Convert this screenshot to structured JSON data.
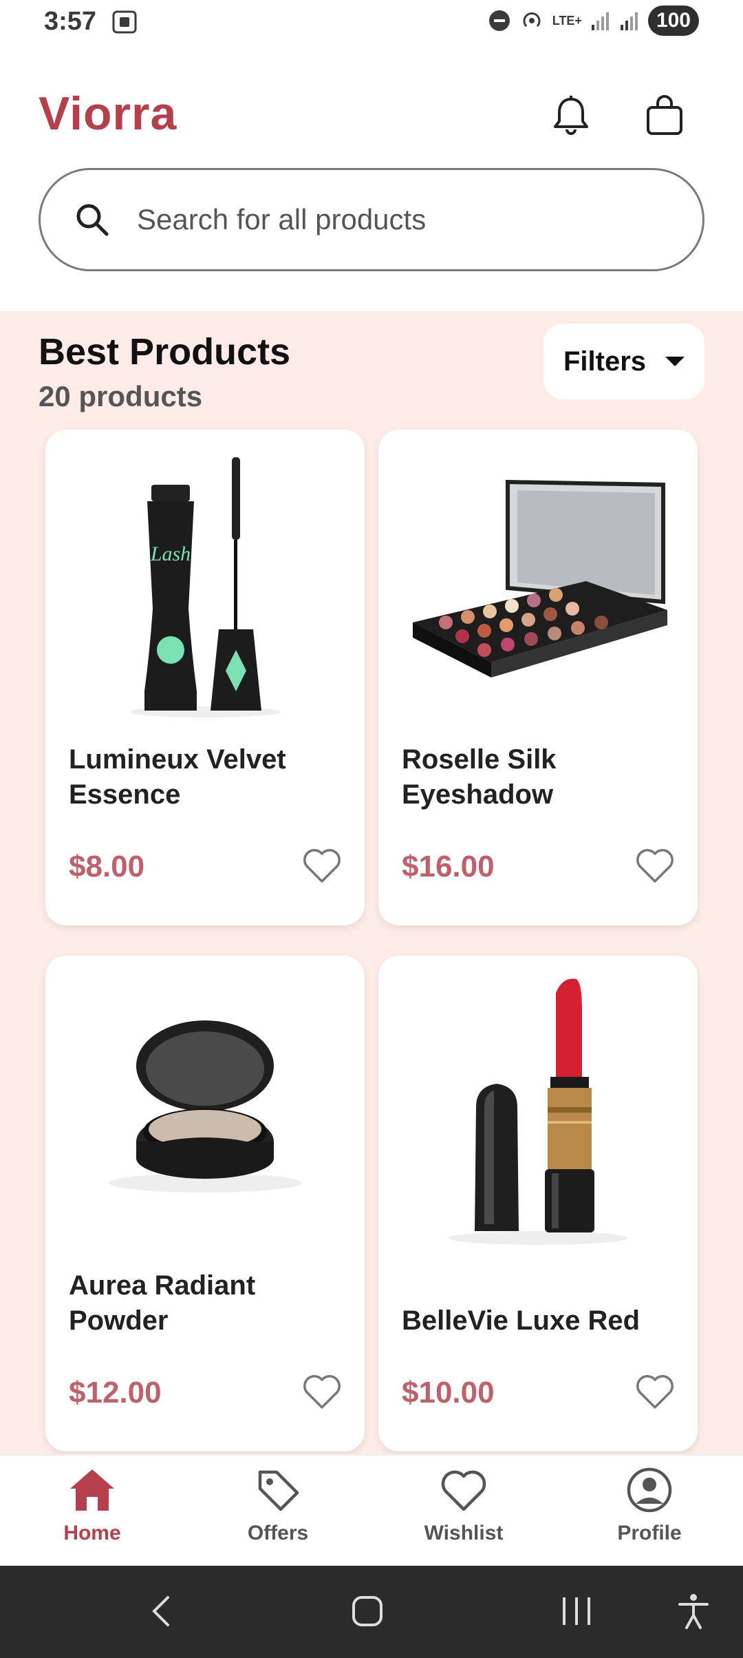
{
  "status_bar": {
    "time": "3:57",
    "network": "LTE+",
    "battery": "100"
  },
  "header": {
    "title": "Viorra",
    "icons": [
      "bell-icon",
      "shopping-bag-icon"
    ]
  },
  "search": {
    "placeholder": "Search for all products"
  },
  "section": {
    "title": "Best Products",
    "count": "20 products",
    "filters_label": "Filters"
  },
  "products": [
    {
      "name": "Lumineux Velvet Essence",
      "price": "$8.00",
      "image": "mascara-image"
    },
    {
      "name": "Roselle Silk Eyeshadow",
      "price": "$16.00",
      "image": "eyeshadow-palette-image"
    },
    {
      "name": "Aurea Radiant Powder",
      "price": "$12.00",
      "image": "compact-powder-image"
    },
    {
      "name": "BelleVie Luxe Red",
      "price": "$10.00",
      "image": "lipstick-image"
    }
  ],
  "bottom_nav": [
    {
      "label": "Home",
      "icon": "home-icon",
      "active": true
    },
    {
      "label": "Offers",
      "icon": "tag-icon",
      "active": false
    },
    {
      "label": "Wishlist",
      "icon": "heart-icon",
      "active": false
    },
    {
      "label": "Profile",
      "icon": "user-icon",
      "active": false
    }
  ],
  "colors": {
    "brand": "#b5404c",
    "price": "#c0606c",
    "section_bg": "#fcebe6",
    "system_nav": "#2b2b2b"
  }
}
